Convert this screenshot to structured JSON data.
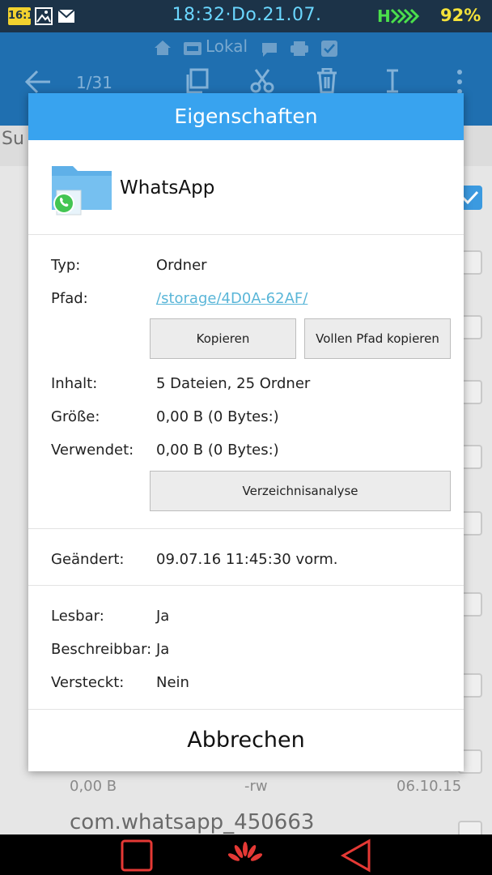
{
  "statusbar": {
    "badge1": "16:1",
    "time": "18:32·Do.21.07.",
    "network": "H",
    "battery": "92%"
  },
  "appbar": {
    "location": "Lokal",
    "page_counter": "1/31",
    "icons": [
      "home-icon",
      "drive-icon",
      "chat-icon",
      "printer-icon",
      "cloud-icon",
      "back-arrow-icon",
      "copy-icon",
      "cut-icon",
      "delete-icon",
      "text-cursor-icon",
      "overflow-menu-icon"
    ]
  },
  "background": {
    "subbar_text": "Su",
    "row_size": "0,00 B",
    "row_perm": "-rw",
    "row_date": "06.10.15",
    "row_name": "com.whatsapp_450663"
  },
  "dialog": {
    "title": "Eigenschaften",
    "folder_name": "WhatsApp",
    "type_label": "Typ:",
    "type_value": "Ordner",
    "path_label": "Pfad:",
    "path_value": "/storage/4D0A-62AF/",
    "copy_button": "Kopieren",
    "copy_full_path_button": "Vollen Pfad kopieren",
    "content_label": "Inhalt:",
    "content_value": "5 Dateien, 25 Ordner",
    "size_label": "Größe:",
    "size_value": "0,00 B (0 Bytes:)",
    "used_label": "Verwendet:",
    "used_value": "0,00 B (0 Bytes:)",
    "analysis_button": "Verzeichnisanalyse",
    "modified_label": "Geändert:",
    "modified_value": "09.07.16 11:45:30 vorm.",
    "readable_label": "Lesbar:",
    "readable_value": "Ja",
    "writable_label": "Beschreibbar:",
    "writable_value": "Ja",
    "hidden_label": "Versteckt:",
    "hidden_value": "Nein",
    "cancel_button": "Abbrechen"
  },
  "colors": {
    "status_bg": "#1c3348",
    "appbar_bg": "#1f6fb0",
    "dialog_title_bg": "#38a3ef",
    "link": "#5ab6d8",
    "battery": "#f4e23a",
    "network": "#4be04b",
    "time": "#6bd7ff"
  }
}
